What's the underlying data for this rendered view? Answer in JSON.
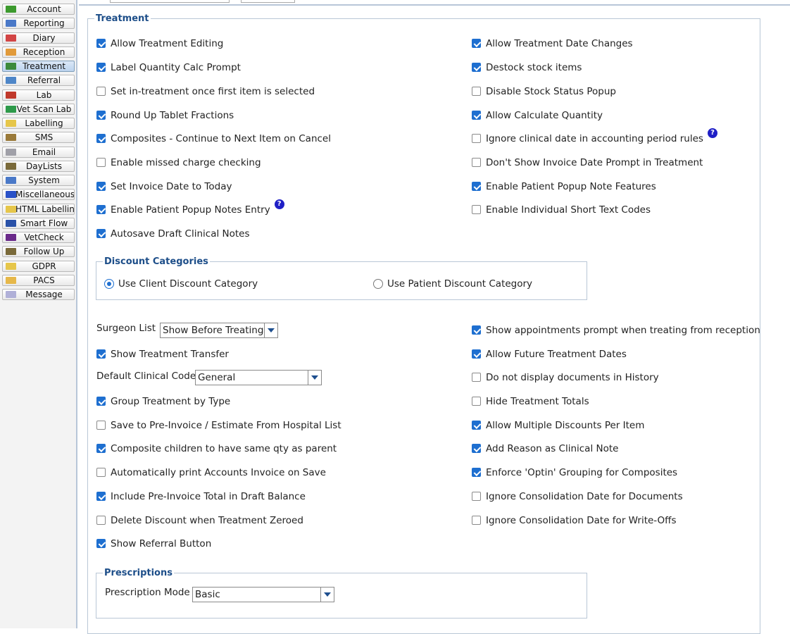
{
  "sidebar": {
    "items": [
      {
        "label": "Account",
        "icon": "account-icon",
        "color": "#3c9a2e"
      },
      {
        "label": "Reporting",
        "icon": "reporting-icon",
        "color": "#4a79c8"
      },
      {
        "label": "Diary",
        "icon": "diary-icon",
        "color": "#d24545"
      },
      {
        "label": "Reception",
        "icon": "reception-icon",
        "color": "#e19a3a"
      },
      {
        "label": "Treatment",
        "icon": "treatment-icon",
        "color": "#3c8a3c",
        "active": true
      },
      {
        "label": "Referral",
        "icon": "referral-icon",
        "color": "#4e86c8"
      },
      {
        "label": "Lab",
        "icon": "lab-icon",
        "color": "#c0392b"
      },
      {
        "label": "Vet Scan Lab",
        "icon": "vet-scan-lab-icon",
        "color": "#2e9a4a"
      },
      {
        "label": "Labelling",
        "icon": "labelling-icon",
        "color": "#e6c64a"
      },
      {
        "label": "SMS",
        "icon": "sms-icon",
        "color": "#9a7a3a"
      },
      {
        "label": "Email",
        "icon": "email-icon",
        "color": "#a0a0a8"
      },
      {
        "label": "DayLists",
        "icon": "daylists-icon",
        "color": "#7a6a3a"
      },
      {
        "label": "System",
        "icon": "system-icon",
        "color": "#4a79c8"
      },
      {
        "label": "Miscellaneous",
        "icon": "miscellaneous-icon",
        "color": "#2a52c8"
      },
      {
        "label": "HTML Labelling",
        "icon": "html-labelling-icon",
        "color": "#e6c64a"
      },
      {
        "label": "Smart Flow",
        "icon": "smart-flow-icon",
        "color": "#2a52a8"
      },
      {
        "label": "VetCheck",
        "icon": "vetcheck-icon",
        "color": "#6a2a8a"
      },
      {
        "label": "Follow Up",
        "icon": "follow-up-icon",
        "color": "#7a6a3a"
      },
      {
        "label": "GDPR",
        "icon": "gdpr-icon",
        "color": "#e6c64a"
      },
      {
        "label": "PACS",
        "icon": "pacs-icon",
        "color": "#e6b84a"
      },
      {
        "label": "Message",
        "icon": "message-icon",
        "color": "#b0b0d8"
      }
    ]
  },
  "treatment": {
    "legend": "Treatment",
    "left": [
      {
        "label": "Allow Treatment Editing",
        "checked": true
      },
      {
        "label": "Label Quantity Calc Prompt",
        "checked": true
      },
      {
        "label": "Set in-treatment once first item is selected",
        "checked": false
      },
      {
        "label": "Round Up Tablet Fractions",
        "checked": true
      },
      {
        "label": "Composites - Continue to Next Item on Cancel",
        "checked": true
      },
      {
        "label": "Enable missed charge checking",
        "checked": false
      },
      {
        "label": "Set Invoice Date to Today",
        "checked": true
      },
      {
        "label": "Enable Patient Popup Notes Entry",
        "checked": true,
        "help": true
      },
      {
        "label": "Autosave Draft Clinical Notes",
        "checked": true
      }
    ],
    "right": [
      {
        "label": "Allow Treatment Date Changes",
        "checked": true
      },
      {
        "label": "Destock stock items",
        "checked": true
      },
      {
        "label": "Disable Stock Status Popup",
        "checked": false
      },
      {
        "label": "Allow Calculate Quantity",
        "checked": true
      },
      {
        "label": "Ignore clinical date in accounting period rules",
        "checked": false,
        "help": true
      },
      {
        "label": "Don't Show Invoice Date Prompt in Treatment",
        "checked": false
      },
      {
        "label": "Enable Patient Popup Note Features",
        "checked": true
      },
      {
        "label": "Enable Individual Short Text Codes",
        "checked": false
      }
    ],
    "help_glyph": "?"
  },
  "discount": {
    "legend": "Discount Categories",
    "options": [
      {
        "label": "Use Client Discount Category",
        "selected": true
      },
      {
        "label": "Use Patient Discount Category",
        "selected": false
      }
    ]
  },
  "settings": {
    "surgeon_label": "Surgeon List",
    "surgeon_value": "Show Before Treating",
    "show_transfer": {
      "label": "Show Treatment Transfer",
      "checked": true
    },
    "clinical_code_label": "Default Clinical Code",
    "clinical_code_value": "General",
    "left": [
      {
        "label": "Group Treatment by Type",
        "checked": true
      },
      {
        "label": "Save to Pre-Invoice / Estimate From Hospital List",
        "checked": false
      },
      {
        "label": "Composite children to have same qty as parent",
        "checked": true
      },
      {
        "label": "Automatically print Accounts Invoice on Save",
        "checked": false
      },
      {
        "label": "Include Pre-Invoice Total in Draft Balance",
        "checked": true
      },
      {
        "label": "Delete Discount when Treatment Zeroed",
        "checked": false
      },
      {
        "label": "Show Referral Button",
        "checked": true
      }
    ],
    "right": [
      {
        "label": "Show appointments prompt when treating from reception",
        "checked": true
      },
      {
        "label": "Allow Future Treatment Dates",
        "checked": true
      },
      {
        "label": "Do not display documents in History",
        "checked": false
      },
      {
        "label": "Hide Treatment Totals",
        "checked": false
      },
      {
        "label": "Allow Multiple Discounts Per Item",
        "checked": true
      },
      {
        "label": "Add Reason as Clinical Note",
        "checked": true
      },
      {
        "label": "Enforce 'Optin' Grouping for Composites",
        "checked": true
      },
      {
        "label": "Ignore Consolidation Date for Documents",
        "checked": false
      },
      {
        "label": "Ignore Consolidation Date for Write-Offs",
        "checked": false
      }
    ]
  },
  "prescriptions": {
    "legend": "Prescriptions",
    "mode_label": "Prescription Mode",
    "mode_value": "Basic"
  },
  "colors": {
    "accent": "#1e6fd0",
    "legend": "#1d4e89",
    "help": "#1f1fc6"
  }
}
